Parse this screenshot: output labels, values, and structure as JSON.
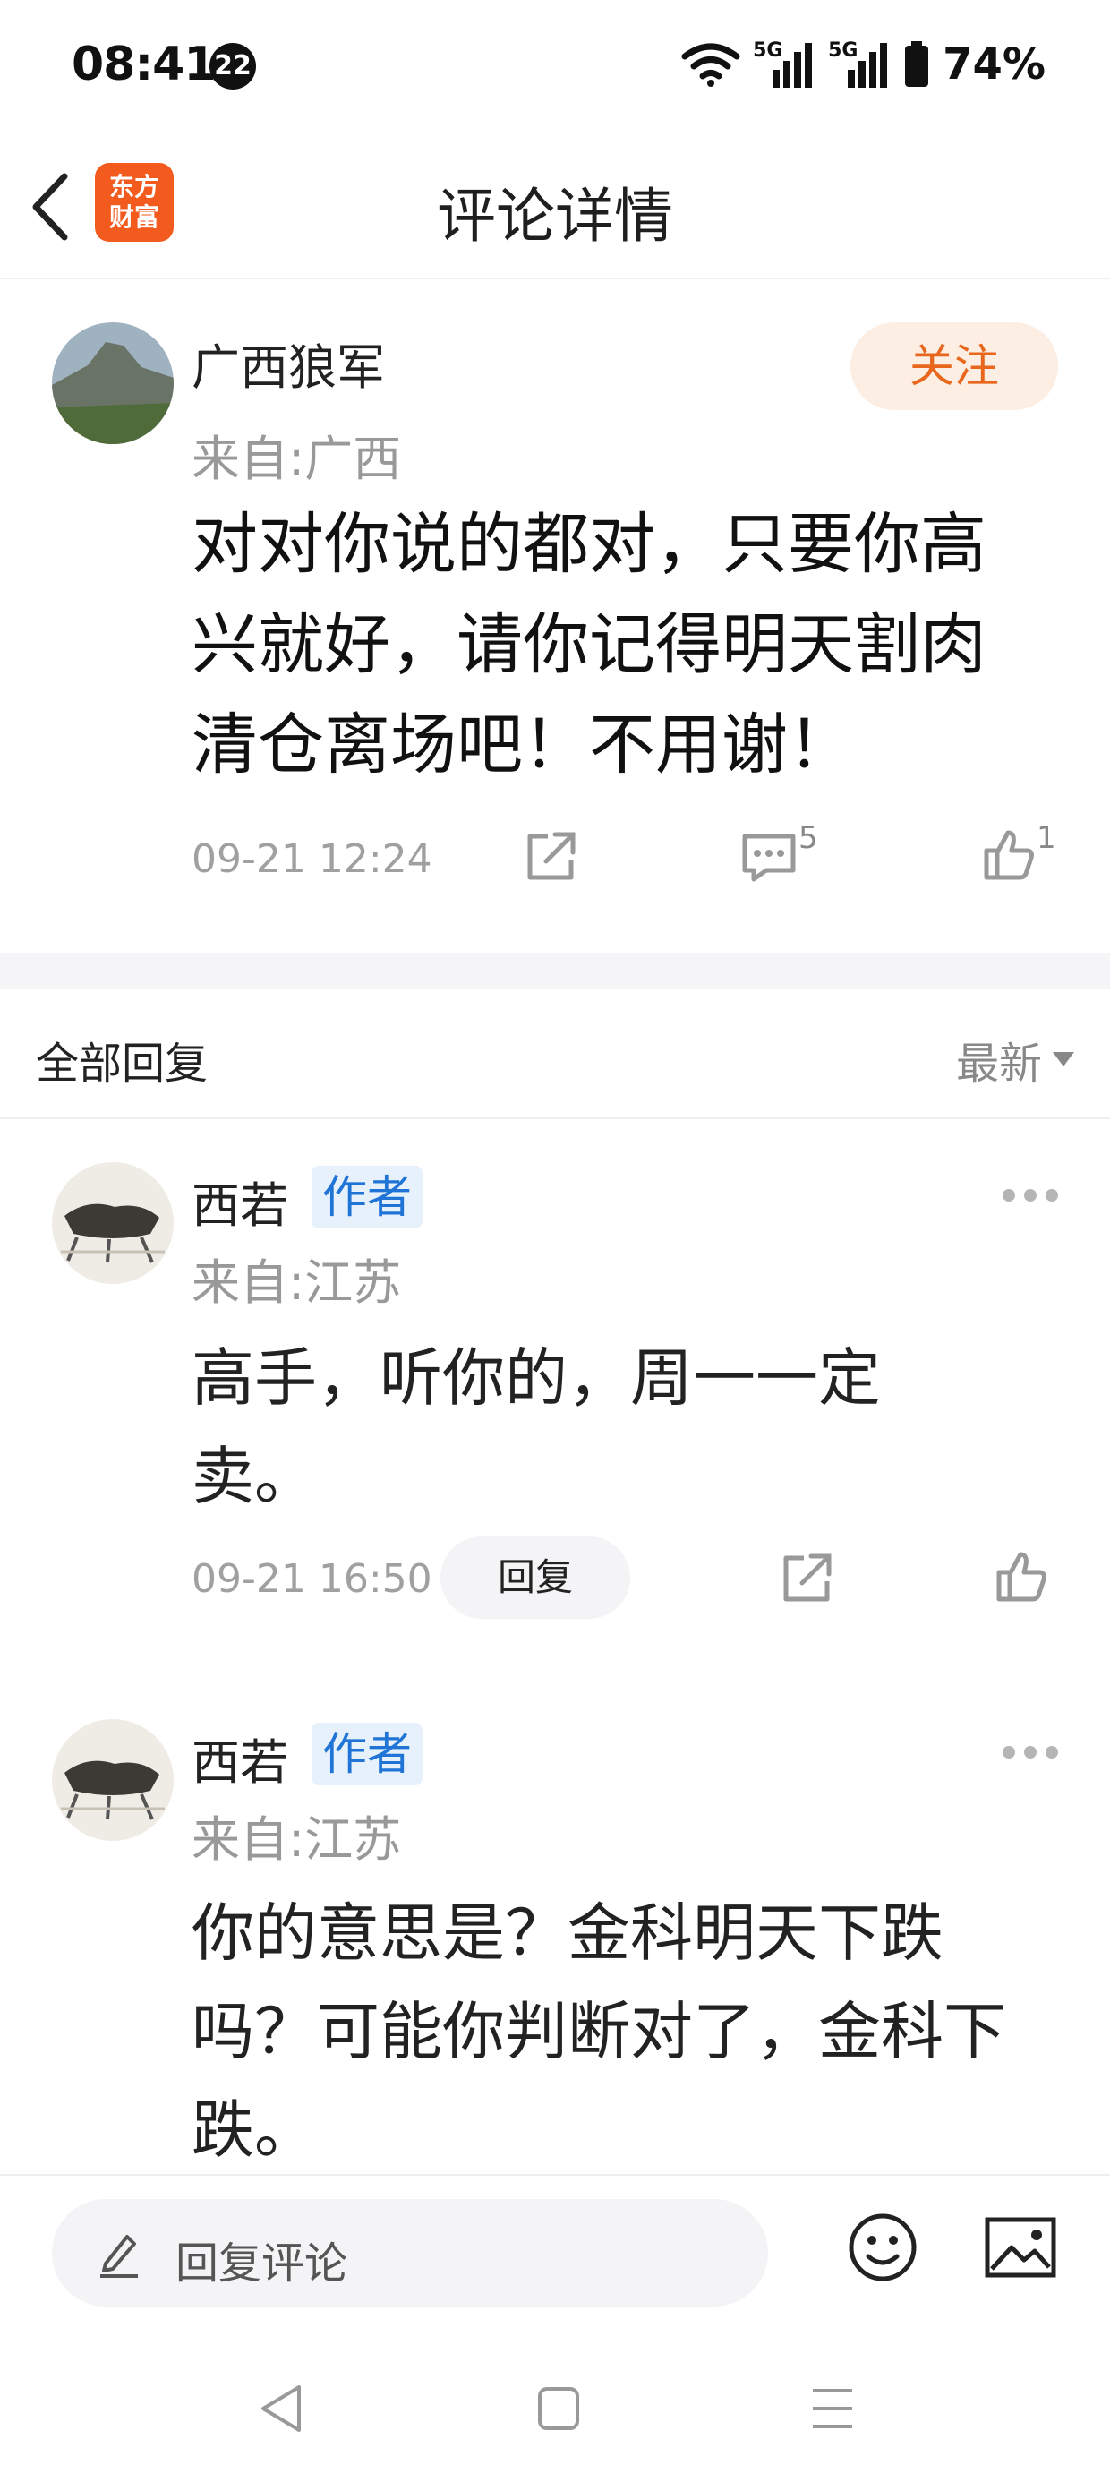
{
  "status_bar": {
    "time": "08:41",
    "notification_count": "22",
    "network_1": "5G",
    "network_2": "5G",
    "battery": "74%"
  },
  "header": {
    "logo_line1": "东方",
    "logo_line2": "财富",
    "title": "评论详情"
  },
  "main_comment": {
    "username": "广西狼军",
    "location": "来自:广西",
    "follow_label": "关注",
    "text": "对对你说的都对，只要你高兴就好，请你记得明天割肉清仓离场吧！不用谢！",
    "timestamp": "09-21 12:24",
    "reply_count": "5",
    "like_count": "1"
  },
  "replies_section": {
    "title": "全部回复",
    "sort_label": "最新"
  },
  "replies": [
    {
      "username": "西若",
      "badge": "作者",
      "location": "来自:江苏",
      "text": "高手，听你的，周一一定卖。",
      "timestamp": "09-21 16:50",
      "reply_button": "回复"
    },
    {
      "username": "西若",
      "badge": "作者",
      "location": "来自:江苏",
      "text": "你的意思是？金科明天下跌吗？可能你判断对了，金科下跌。"
    }
  ],
  "bottom_bar": {
    "reply_placeholder": "回复评论"
  },
  "colors": {
    "accent_orange": "#e8671d",
    "logo_orange": "#f25a1e",
    "badge_blue": "#1f74d6",
    "meta_gray": "#a0a0a0"
  },
  "icons": [
    "back-arrow-icon",
    "share-icon",
    "comment-icon",
    "like-icon",
    "more-dots-icon",
    "pencil-icon",
    "emoji-icon",
    "image-icon",
    "nav-back-icon",
    "nav-home-icon",
    "nav-menu-icon",
    "wifi-icon",
    "signal-icon",
    "battery-icon"
  ]
}
